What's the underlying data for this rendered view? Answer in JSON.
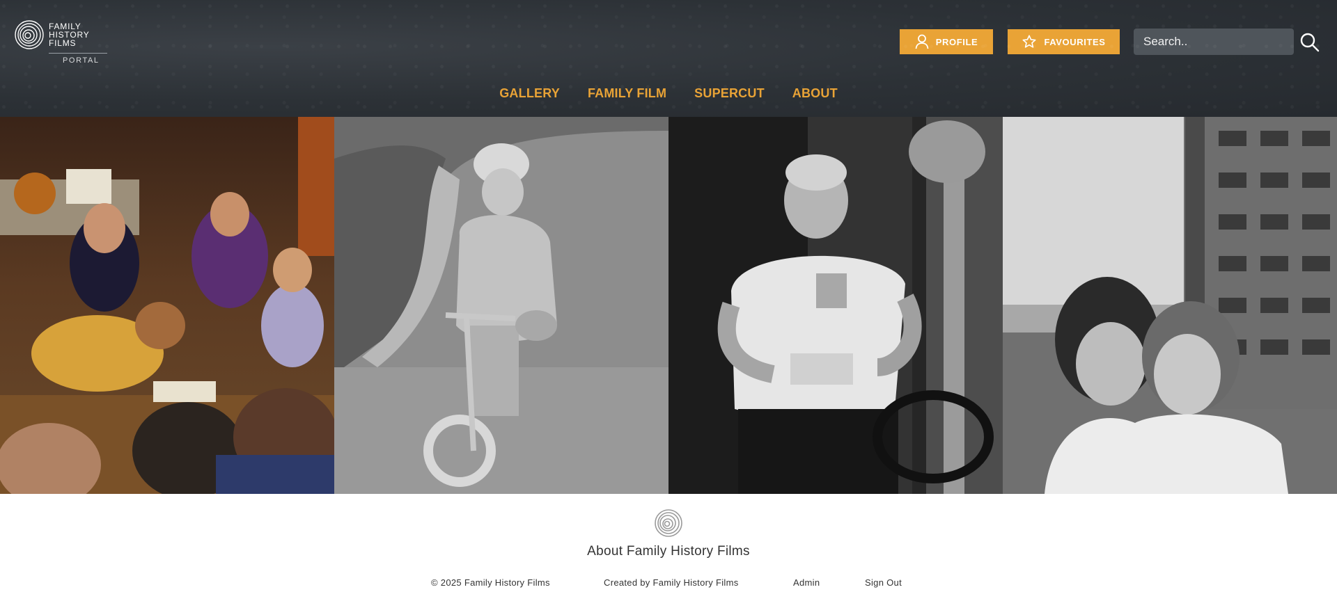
{
  "brand": {
    "logo_lines": [
      "FAMILY",
      "HISTORY",
      "FILMS"
    ],
    "logo_sub": "PORTAL"
  },
  "header": {
    "profile_label": "PROFILE",
    "favourites_label": "FAVOURITES",
    "search_placeholder": "Search..",
    "search_value": ""
  },
  "nav": {
    "items": [
      {
        "label": "GALLERY"
      },
      {
        "label": "FAMILY FILM"
      },
      {
        "label": "SUPERCUT"
      },
      {
        "label": "ABOUT"
      }
    ]
  },
  "photos": [
    {
      "subject": "children at a birthday party blowing out candles",
      "tone": "color"
    },
    {
      "subject": "girl in helmet riding a bicycle",
      "tone": "black-and-white"
    },
    {
      "subject": "man holding a mug and a box",
      "tone": "black-and-white"
    },
    {
      "subject": "two women posing on a rooftop",
      "tone": "black-and-white"
    }
  ],
  "footer": {
    "title": "About Family History Films",
    "copyright": "© 2025 Family History Films",
    "created_by": "Created by Family History Films",
    "admin": "Admin",
    "sign_out": "Sign Out"
  },
  "colors": {
    "accent": "#e9a336",
    "header_bg": "#2c3136",
    "search_bg": "#4f555b",
    "footer_text": "#333333"
  },
  "icons": {
    "logo": "concentric-rings-logo",
    "profile": "person-icon",
    "favourites": "star-icon",
    "search": "magnifier-icon"
  }
}
